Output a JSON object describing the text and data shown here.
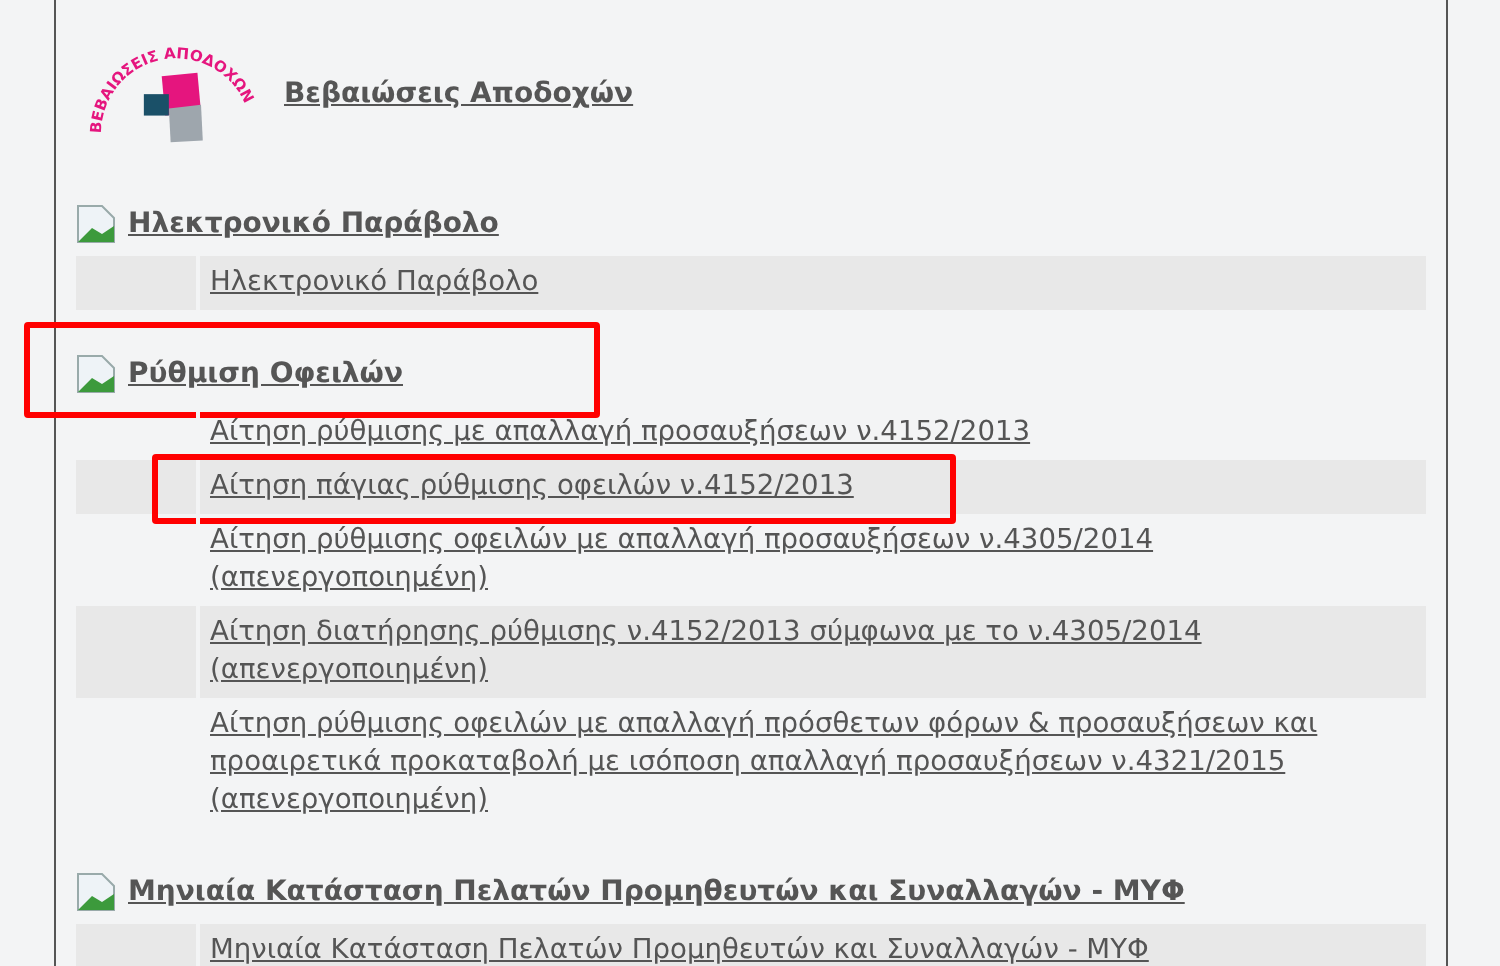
{
  "header": {
    "logo_text": "ΒΕΒΑΙΩΣΕΙΣ ΑΠΟΔΟΧΩΝ",
    "title": "Βεβαιώσεις Αποδοχών"
  },
  "sections": [
    {
      "title": "Ηλεκτρονικό Παράβολο",
      "highlighted": false,
      "items": [
        {
          "label": "Ηλεκτρονικό Παράβολο",
          "shaded": true,
          "highlighted": false
        }
      ]
    },
    {
      "title": "Ρύθμιση Οφειλών",
      "highlighted": true,
      "items": [
        {
          "label": "Αίτηση ρύθμισης με απαλλαγή προσαυξήσεων ν.4152/2013",
          "shaded": false,
          "highlighted": false
        },
        {
          "label": "Αίτηση πάγιας ρύθμισης οφειλών ν.4152/2013",
          "shaded": true,
          "highlighted": true
        },
        {
          "label": "Αίτηση ρύθμισης οφειλών με απαλλαγή προσαυξήσεων ν.4305/2014 (απενεργοποιημένη)",
          "shaded": false,
          "highlighted": false
        },
        {
          "label": "Αίτηση διατήρησης ρύθμισης ν.4152/2013 σύμφωνα με το ν.4305/2014 (απενεργοποιημένη)",
          "shaded": true,
          "highlighted": false
        },
        {
          "label": "Αίτηση ρύθμισης οφειλών με απαλλαγή πρόσθετων φόρων & προσαυξήσεων και προαιρετικά προκαταβολή με ισόποση απαλλαγή προσαυξήσεων ν.4321/2015 (απενεργοποιημένη)",
          "shaded": false,
          "highlighted": false
        }
      ]
    },
    {
      "title": "Μηνιαία Κατάσταση Πελατών Προμηθευτών και Συναλλαγών - ΜΥΦ",
      "highlighted": false,
      "items": [
        {
          "label": "Μηνιαία Κατάσταση Πελατών Προμηθευτών και Συναλλαγών - ΜΥΦ",
          "shaded": true,
          "highlighted": false
        }
      ]
    }
  ]
}
